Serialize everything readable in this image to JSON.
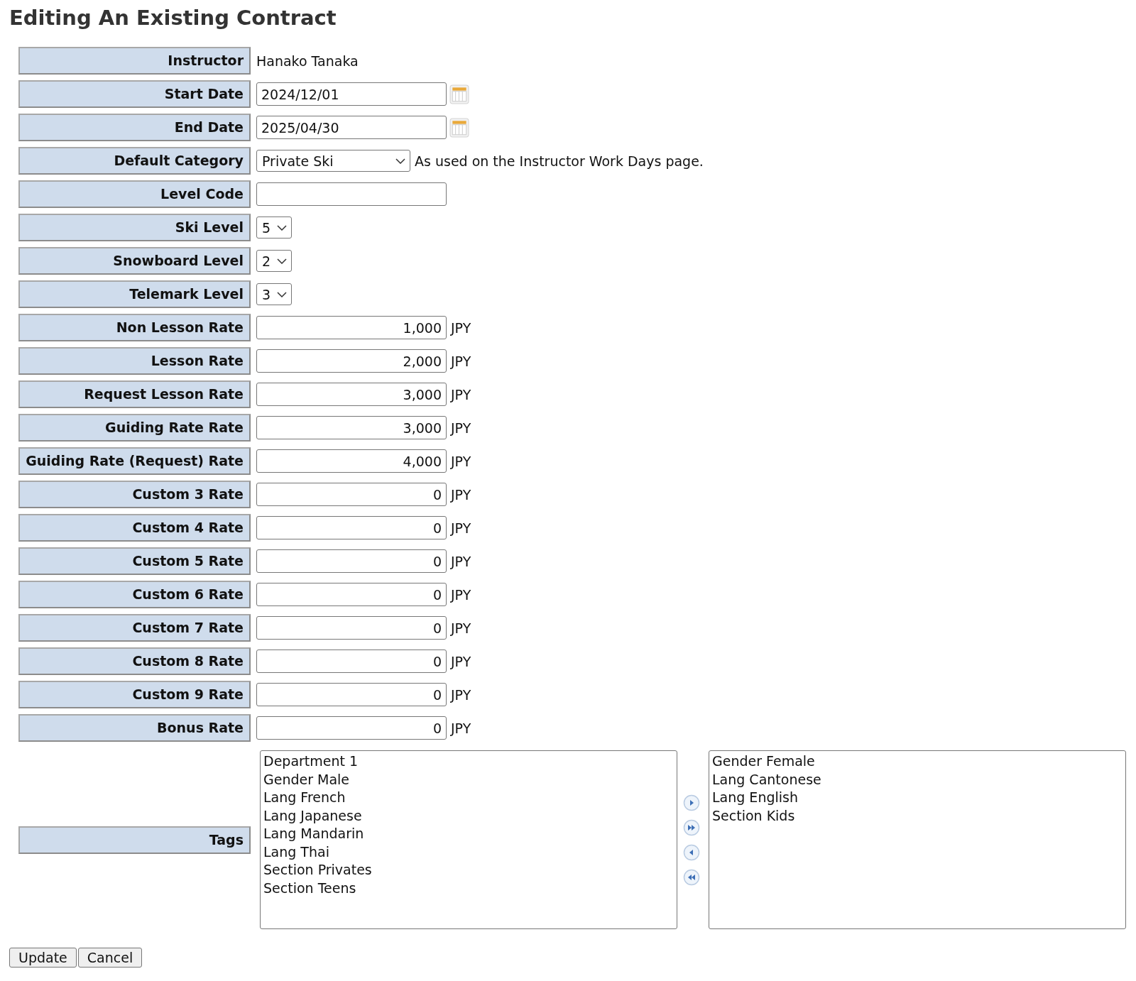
{
  "title": "Editing An Existing Contract",
  "fields": [
    {
      "kind": "text",
      "label": "Instructor",
      "value": "Hanako Tanaka"
    },
    {
      "kind": "date",
      "label": "Start Date",
      "value": "2024/12/01"
    },
    {
      "kind": "date",
      "label": "End Date",
      "value": "2025/04/30"
    },
    {
      "kind": "select",
      "label": "Default Category",
      "value": "Private Ski",
      "note": "As used on the Instructor Work Days page."
    },
    {
      "kind": "input",
      "label": "Level Code"
    },
    {
      "kind": "level",
      "label": "Ski Level",
      "value": "5"
    },
    {
      "kind": "level",
      "label": "Snowboard Level",
      "value": "2"
    },
    {
      "kind": "level",
      "label": "Telemark Level",
      "value": "3"
    },
    {
      "kind": "rate",
      "label": "Non Lesson Rate",
      "value": "1,000",
      "unit": "JPY"
    },
    {
      "kind": "rate",
      "label": "Lesson Rate",
      "value": "2,000",
      "unit": "JPY"
    },
    {
      "kind": "rate",
      "label": "Request Lesson Rate",
      "value": "3,000",
      "unit": "JPY"
    },
    {
      "kind": "rate",
      "label": "Guiding Rate Rate",
      "value": "3,000",
      "unit": "JPY"
    },
    {
      "kind": "rate",
      "label": "Guiding Rate (Request) Rate",
      "value": "4,000",
      "unit": "JPY"
    },
    {
      "kind": "rate",
      "label": "Custom 3 Rate",
      "value": "0",
      "unit": "JPY"
    },
    {
      "kind": "rate",
      "label": "Custom 4 Rate",
      "value": "0",
      "unit": "JPY"
    },
    {
      "kind": "rate",
      "label": "Custom 5 Rate",
      "value": "0",
      "unit": "JPY"
    },
    {
      "kind": "rate",
      "label": "Custom 6 Rate",
      "value": "0",
      "unit": "JPY"
    },
    {
      "kind": "rate",
      "label": "Custom 7 Rate",
      "value": "0",
      "unit": "JPY"
    },
    {
      "kind": "rate",
      "label": "Custom 8 Rate",
      "value": "0",
      "unit": "JPY"
    },
    {
      "kind": "rate",
      "label": "Custom 9 Rate",
      "value": "0",
      "unit": "JPY"
    },
    {
      "kind": "rate",
      "label": "Bonus Rate",
      "value": "0",
      "unit": "JPY"
    }
  ],
  "tags": {
    "label": "Tags",
    "available": [
      "Department 1",
      "Gender Male",
      "Lang French",
      "Lang Japanese",
      "Lang Mandarin",
      "Lang Thai",
      "Section Privates",
      "Section Teens"
    ],
    "assigned": [
      "Gender Female",
      "Lang Cantonese",
      "Lang English",
      "Section Kids"
    ]
  },
  "buttons": [
    "Update",
    "Cancel"
  ]
}
